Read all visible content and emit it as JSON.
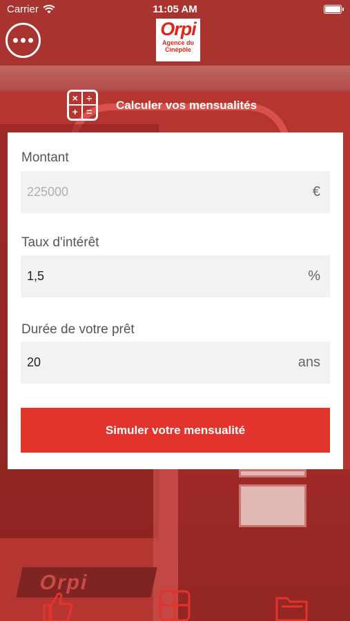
{
  "status_bar": {
    "carrier": "Carrier",
    "time": "11:05 AM"
  },
  "logo": {
    "brand": "Orpi",
    "agency_line1": "Agence du",
    "agency_line2": "Cinépôle"
  },
  "header": {
    "title": "Calculer vos mensualités",
    "icon": "calculator-icon"
  },
  "form": {
    "amount": {
      "label": "Montant",
      "placeholder": "225000",
      "unit": "€"
    },
    "rate": {
      "label": "Taux d'intérêt",
      "value": "1,5",
      "unit": "%"
    },
    "duration": {
      "label": "Durée de votre prêt",
      "value": "20",
      "unit": "ans"
    },
    "submit_label": "Simuler votre mensualité"
  },
  "background_sign": "Orpi",
  "colors": {
    "accent": "#e2332c",
    "overlay": "#b8322f"
  }
}
